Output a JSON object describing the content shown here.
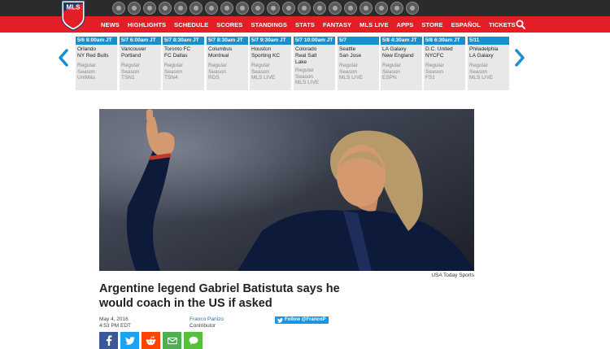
{
  "nav": {
    "items": [
      "NEWS",
      "HIGHLIGHTS",
      "SCHEDULE",
      "SCORES",
      "STANDINGS",
      "STATS",
      "FANTASY",
      "MLS LIVE",
      "APPS",
      "STORE",
      "ESPAÑOL",
      "TICKETS"
    ]
  },
  "brand": {
    "logo_text": "MLS",
    "logo_color": "#e41e26"
  },
  "colors": {
    "nav_red": "#e41e26",
    "top_dark": "#2b2b2b",
    "match_blue": "#1a8fd0",
    "twitter_blue": "#1b95e0"
  },
  "matches": [
    {
      "header": "5/6  8:00am JT",
      "teams": [
        "Orlando",
        "NY Red Bulls"
      ],
      "info": [
        "Regular",
        "Season",
        "UniMás"
      ]
    },
    {
      "header": "5/7  6:00am JT",
      "teams": [
        "Vancouver",
        "Portland"
      ],
      "info": [
        "Regular",
        "Season",
        "TSN1"
      ]
    },
    {
      "header": "5/7  8:30am JT",
      "teams": [
        "Toronto FC",
        "FC Dallas"
      ],
      "info": [
        "Regular",
        "Season",
        "TSN4"
      ]
    },
    {
      "header": "5/7  8:30am JT",
      "teams": [
        "Columbus",
        "Montreal"
      ],
      "info": [
        "Regular",
        "Season",
        "RDS"
      ]
    },
    {
      "header": "5/7  9:30am JT",
      "teams": [
        "Houston",
        "Sporting KC"
      ],
      "info": [
        "Regular",
        "Season",
        "MLS LIVE"
      ]
    },
    {
      "header": "5/7  10:00am JT",
      "teams": [
        "Colorado",
        "Real Salt",
        "Lake"
      ],
      "info": [
        "Regular",
        "Season",
        "MLS LIVE"
      ]
    },
    {
      "header": "5/7",
      "teams": [
        "Seattle",
        "San Jose"
      ],
      "info": [
        "Regular",
        "Season",
        "MLS LIVE"
      ]
    },
    {
      "header": "5/8  4:30am JT",
      "teams": [
        "LA Galaxy",
        "New England"
      ],
      "info": [
        "Regular",
        "Season",
        "ESPN"
      ]
    },
    {
      "header": "5/8  6:30am JT",
      "teams": [
        "D.C. United",
        "NYCFC"
      ],
      "info": [
        "Regular",
        "Season",
        "FS1"
      ]
    },
    {
      "header": "5/11",
      "teams": [
        "Philadelphia",
        "LA Galaxy"
      ],
      "info": [
        "Regular",
        "Season",
        "MLS LIVE"
      ]
    }
  ],
  "article": {
    "photo_credit": "USA Today Sports",
    "headline": "Argentine legend Gabriel Batistuta says he would coach in the US if asked",
    "date": "May 4, 2016",
    "time": "4:53 PM EDT",
    "author": "Franco Panizo",
    "author_role": "Contributor",
    "follow_label": "Follow @FrancoP"
  },
  "share": [
    {
      "icon": "facebook-icon",
      "color": "#3b5998"
    },
    {
      "icon": "twitter-icon",
      "color": "#1da1f2"
    },
    {
      "icon": "reddit-icon",
      "color": "#ff4500"
    },
    {
      "icon": "email-icon",
      "color": "#4caf50"
    },
    {
      "icon": "comment-icon",
      "color": "#57c03a"
    }
  ]
}
